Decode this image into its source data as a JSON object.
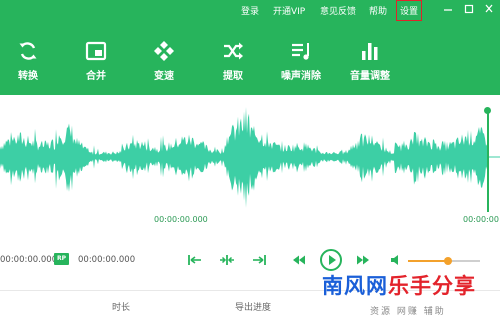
{
  "topmenu": {
    "login": "登录",
    "vip": "开通VIP",
    "feedback": "意见反馈",
    "help": "帮助",
    "settings": "设置"
  },
  "window_controls": [
    "minimize-icon",
    "maximize-icon",
    "close-icon"
  ],
  "toolbar": [
    {
      "label": "转换",
      "icon": "convert-icon"
    },
    {
      "label": "合并",
      "icon": "merge-icon"
    },
    {
      "label": "变速",
      "icon": "speed-icon"
    },
    {
      "label": "提取",
      "icon": "extract-icon"
    },
    {
      "label": "噪声消除",
      "icon": "noise-removal-icon"
    },
    {
      "label": "音量调整",
      "icon": "volume-adjust-icon"
    }
  ],
  "waveform": {
    "time_center": "00:00:00.000",
    "time_right": "00:00:00"
  },
  "transport": {
    "time_start": "00:00:00.000",
    "rp_badge": "RP",
    "time_end": "00:00:00.000",
    "volume_level": 0.55
  },
  "columns": {
    "duration": "时长",
    "export_progress": "导出进度"
  },
  "watermark": {
    "blue": "南风网",
    "red": "乐手分享",
    "sub": "资源 网赚 辅助"
  },
  "colors": {
    "brand_green": "#27b45c",
    "wave_teal": "#3dcfa5",
    "accent_orange": "#f3a12c",
    "highlight_red": "#e0232b"
  }
}
